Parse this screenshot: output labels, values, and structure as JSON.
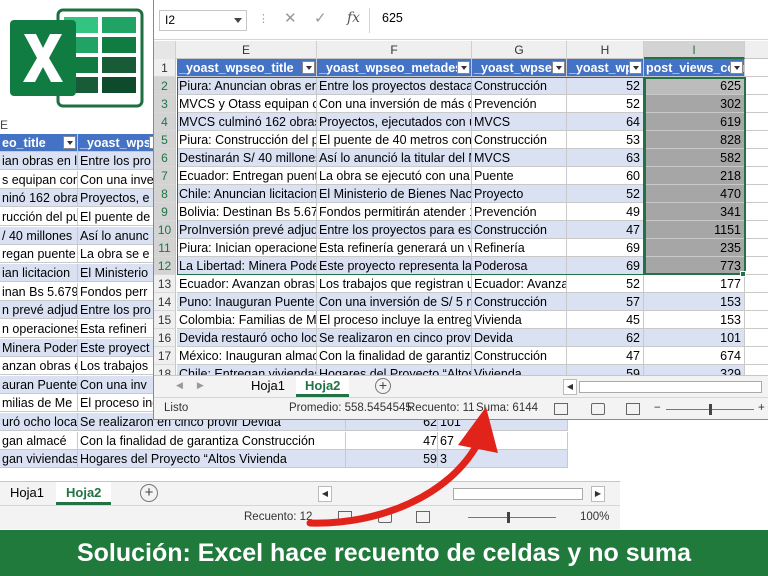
{
  "front": {
    "name_box": "I2",
    "formula_value": "625",
    "columns": [
      "E",
      "F",
      "G",
      "H",
      "I"
    ],
    "selected_column": "I",
    "headers": [
      "_yoast_wpseo_title",
      "_yoast_wpseo_metadesc",
      "_yoast_wpse",
      "_yoast_wps",
      "post_views_count"
    ],
    "rows": [
      {
        "n": "2",
        "e": "Piura: Anuncian obras en l",
        "f": "Entre los proyectos destacan",
        "g": "Construcción",
        "h": "52",
        "i": "625"
      },
      {
        "n": "3",
        "e": "MVCS y Otass equipan con",
        "f": "Con una inversión de más de",
        "g": "Prevención",
        "h": "52",
        "i": "302"
      },
      {
        "n": "4",
        "e": "MVCS culminó 162 obras d",
        "f": "Proyectos, ejecutados con u",
        "g": "MVCS",
        "h": "64",
        "i": "619"
      },
      {
        "n": "5",
        "e": "Piura: Construcción del pu",
        "f": "El puente de 40 metros conta",
        "g": "Construcción",
        "h": "53",
        "i": "828"
      },
      {
        "n": "6",
        "e": "Destinarán S/ 40 millones",
        "f": "Así lo anunció la titular del M",
        "g": "MVCS",
        "h": "63",
        "i": "582"
      },
      {
        "n": "7",
        "e": "Ecuador: Entregan puente",
        "f": "La obra se ejecutó con una ir",
        "g": "Puente",
        "h": "60",
        "i": "218"
      },
      {
        "n": "8",
        "e": "Chile: Anuncian licitacion",
        "f": "El Ministerio de Bienes Nacio",
        "g": "Proyecto",
        "h": "52",
        "i": "470"
      },
      {
        "n": "9",
        "e": "Bolivia: Destinan Bs 5.679.",
        "f": "Fondos permitirán atender 1",
        "g": "Prevención",
        "h": "49",
        "i": "341"
      },
      {
        "n": "10",
        "e": "ProInversión prevé adjudi",
        "f": "Entre los proyectos para este",
        "g": "Construcción",
        "h": "47",
        "i": "1151"
      },
      {
        "n": "11",
        "e": "Piura: Inician operaciones",
        "f": "Esta refinería generará un va",
        "g": "Refinería",
        "h": "69",
        "i": "235"
      },
      {
        "n": "12",
        "e": "La Libertad: Minera Poder",
        "f": "Este proyecto representa la",
        "g": "Poderosa",
        "h": "69",
        "i": "773"
      },
      {
        "n": "13",
        "e": "Ecuador: Avanzan obras el",
        "f": "Los trabajos que registran ur",
        "g": "Ecuador: Avanza",
        "h": "52",
        "i": "177"
      },
      {
        "n": "14",
        "e": "Puno: Inauguran Puente C",
        "f": "Con una inversión de S/ 5 mi",
        "g": "Construcción",
        "h": "57",
        "i": "153"
      },
      {
        "n": "15",
        "e": "Colombia: Familias de Me",
        "f": "El proceso incluye la entrega",
        "g": "Vivienda",
        "h": "45",
        "i": "153"
      },
      {
        "n": "16",
        "e": "Devida restauró ocho loca",
        "f": "Se realizaron en cinco provir",
        "g": "Devida",
        "h": "62",
        "i": "101"
      },
      {
        "n": "17",
        "e": "México: Inauguran almacé",
        "f": "Con la finalidad de garantiza",
        "g": "Construcción",
        "h": "47",
        "i": "674"
      },
      {
        "n": "18",
        "e": "Chile: Entregan viviendas",
        "f": "Hogares del Proyecto “Altos",
        "g": "Vivienda",
        "h": "59",
        "i": "329"
      }
    ],
    "tabs": [
      "Hoja1",
      "Hoja2"
    ],
    "active_tab": "Hoja2",
    "status": {
      "ready": "Listo",
      "average": "Promedio: 558.5454545",
      "count": "Recuento: 11",
      "sum": "Suma: 6144"
    }
  },
  "back": {
    "col_letter": "E",
    "headers": [
      "eo_title",
      "_yoast_wpse"
    ],
    "rows": [
      {
        "a": "ian obras en l",
        "b": "Entre los pro"
      },
      {
        "a": "s equipan con",
        "b": "Con una inve"
      },
      {
        "a": "ninó 162 obras d",
        "b": "Proyectos, e"
      },
      {
        "a": "rucción del pu",
        "b": "El puente de"
      },
      {
        "a": "/ 40 millones",
        "b": "Así lo anunc"
      },
      {
        "a": "regan puente",
        "b": "La obra se e"
      },
      {
        "a": "ian licitacion",
        "b": "El Ministerio"
      },
      {
        "a": "inan Bs 5.679.",
        "b": "Fondos perr"
      },
      {
        "a": "n prevé adjudi",
        "b": "Entre los pro"
      },
      {
        "a": "n operaciones",
        "b": "Esta refineri"
      },
      {
        "a": "Minera Poder",
        "b": "Este proyect"
      },
      {
        "a": "anzan obras el",
        "b": "Los trabajos"
      },
      {
        "a": "auran Puente C",
        "b": "Con una inv"
      },
      {
        "a": "milias de Me",
        "b": "El proceso incluye la entrega Vivienda"
      },
      {
        "a": "uró ocho loca",
        "b": "Se realizaron en cinco provir Devida"
      },
      {
        "a": "gan almacé",
        "b": "Con la finalidad de garantiza Construcción"
      },
      {
        "a": "gan viviendas",
        "b": "Hogares del Proyecto “Altos  Vivienda"
      }
    ],
    "tail_values": [
      {
        "h": "62",
        "i": "101"
      },
      {
        "h": "47",
        "i": "67"
      },
      {
        "h": "59",
        "i": "3"
      }
    ],
    "tabs": [
      "Hoja1",
      "Hoja2"
    ],
    "count": "Recuento: 12",
    "zoom": "100%"
  },
  "banner": "Solución: Excel hace recuento de celdas y no suma",
  "colors": {
    "excel_green": "#217346",
    "table_header": "#4472c4",
    "band": "#d9e1f2",
    "banner_bg": "#1f7a3c",
    "arrow": "#e2231a"
  },
  "icons": [
    "excel-logo-icon",
    "function-icon",
    "cancel-icon",
    "enter-icon",
    "add-sheet-icon",
    "normal-view-icon",
    "page-layout-icon",
    "page-break-icon"
  ]
}
